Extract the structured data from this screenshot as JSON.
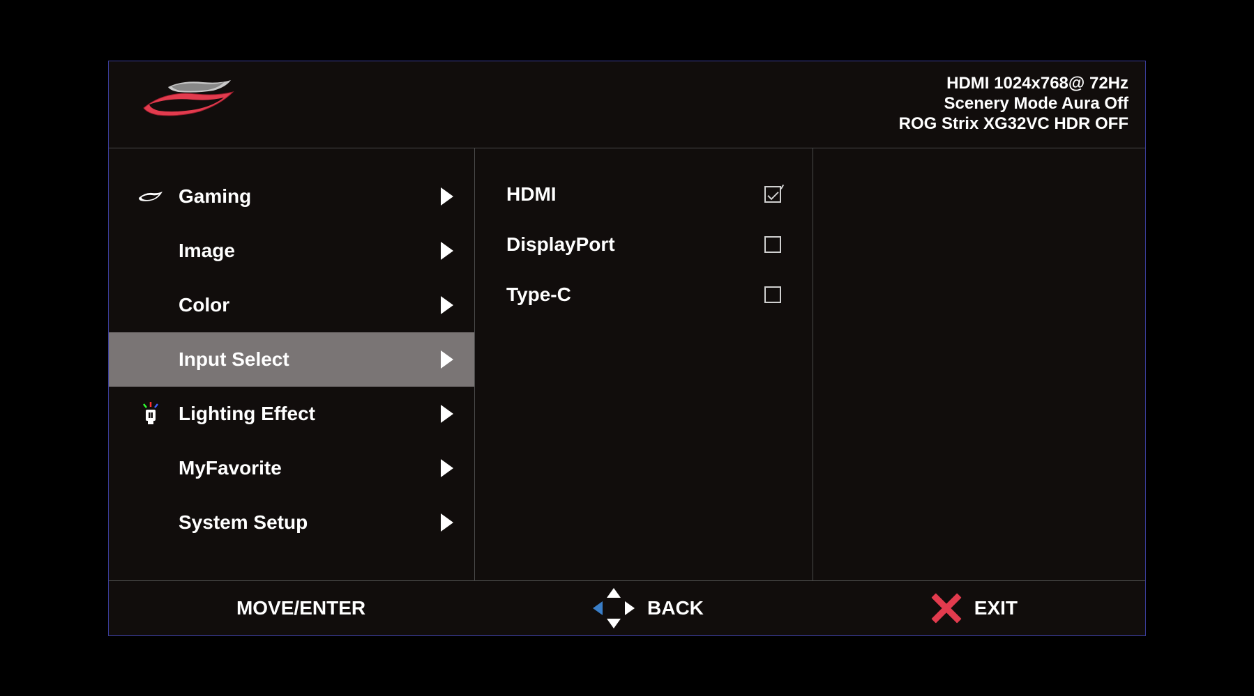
{
  "status": {
    "line1": "HDMI 1024x768@ 72Hz",
    "line2": "Scenery Mode Aura Off",
    "line3": "ROG Strix XG32VC HDR OFF"
  },
  "menu": {
    "items": [
      {
        "label": "Gaming",
        "icon": "rog-eye",
        "active": false
      },
      {
        "label": "Image",
        "icon": null,
        "active": false
      },
      {
        "label": "Color",
        "icon": null,
        "active": false
      },
      {
        "label": "Input Select",
        "icon": null,
        "active": true
      },
      {
        "label": "Lighting Effect",
        "icon": "lighting",
        "active": false
      },
      {
        "label": "MyFavorite",
        "icon": null,
        "active": false
      },
      {
        "label": "System Setup",
        "icon": null,
        "active": false
      }
    ]
  },
  "submenu": {
    "items": [
      {
        "label": "HDMI",
        "checked": true
      },
      {
        "label": "DisplayPort",
        "checked": false
      },
      {
        "label": "Type-C",
        "checked": false
      }
    ]
  },
  "footer": {
    "move_enter": "MOVE/ENTER",
    "back": "BACK",
    "exit": "EXIT"
  }
}
